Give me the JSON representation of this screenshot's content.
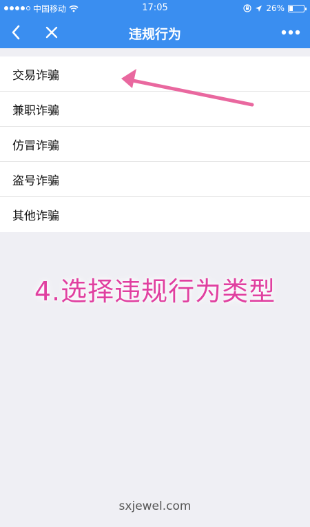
{
  "status_bar": {
    "carrier": "中国移动",
    "time": "17:05",
    "battery": "26%",
    "battery_level": 0.26,
    "signal_filled": 4,
    "signal_total": 5
  },
  "nav": {
    "title": "违规行为",
    "back_icon": "chevron-left-icon",
    "close_icon": "close-icon",
    "more_icon": "more-dots-icon"
  },
  "list": {
    "items": [
      {
        "label": "交易诈骗"
      },
      {
        "label": "兼职诈骗"
      },
      {
        "label": "仿冒诈骗"
      },
      {
        "label": "盗号诈骗"
      },
      {
        "label": "其他诈骗"
      }
    ]
  },
  "annotation": {
    "text": "4.选择违规行为类型",
    "color": "#e040a0"
  },
  "watermark": "sxjewel.com",
  "colors": {
    "header": "#3a8ef0",
    "background": "#efeff4"
  }
}
